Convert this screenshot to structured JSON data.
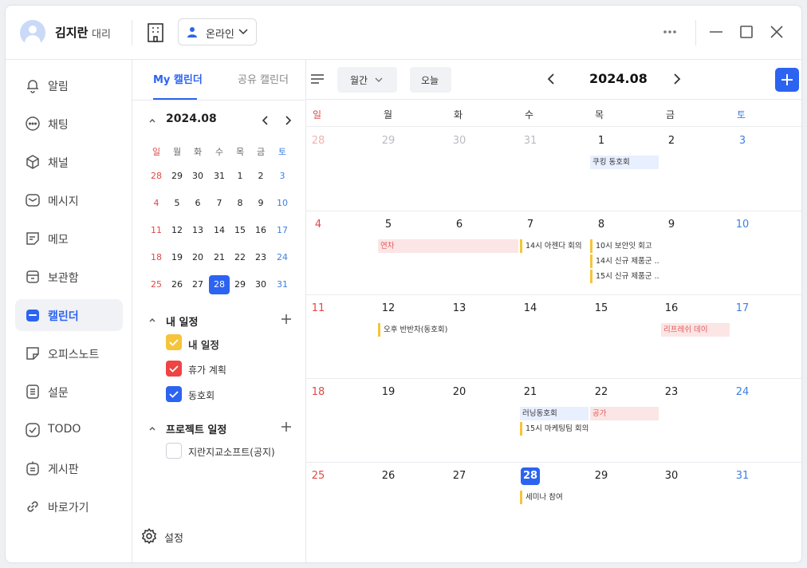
{
  "user": {
    "name": "김지란",
    "rank": "대리"
  },
  "status": {
    "label": "온라인"
  },
  "nav": [
    {
      "label": "알림",
      "icon": "bell-icon"
    },
    {
      "label": "채팅",
      "icon": "chat-icon"
    },
    {
      "label": "채널",
      "icon": "cube-icon"
    },
    {
      "label": "메시지",
      "icon": "envelope-icon"
    },
    {
      "label": "메모",
      "icon": "memo-icon"
    },
    {
      "label": "보관함",
      "icon": "archive-icon"
    },
    {
      "label": "캘린더",
      "icon": "calendar-icon"
    },
    {
      "label": "오피스노트",
      "icon": "note-icon"
    },
    {
      "label": "설문",
      "icon": "survey-icon"
    },
    {
      "label": "TODO",
      "icon": "check-circle-icon"
    },
    {
      "label": "게시판",
      "icon": "board-icon"
    },
    {
      "label": "바로가기",
      "icon": "link-icon"
    }
  ],
  "tabs": {
    "my": "My 캘린더",
    "shared": "공유 캘린더"
  },
  "mini_calendar": {
    "title": "2024.08",
    "weekdays": [
      "일",
      "월",
      "화",
      "수",
      "목",
      "금",
      "토"
    ],
    "weeks": [
      [
        "28",
        "29",
        "30",
        "31",
        "1",
        "2",
        "3"
      ],
      [
        "4",
        "5",
        "6",
        "7",
        "8",
        "9",
        "10"
      ],
      [
        "11",
        "12",
        "13",
        "14",
        "15",
        "16",
        "17"
      ],
      [
        "18",
        "19",
        "20",
        "21",
        "22",
        "23",
        "24"
      ],
      [
        "25",
        "26",
        "27",
        "28",
        "29",
        "30",
        "31"
      ]
    ]
  },
  "my_schedule": {
    "title": "내 일정",
    "items": [
      {
        "label": "내 일정",
        "color": "#f5c43a"
      },
      {
        "label": "휴가 계획",
        "color": "#ee4444"
      },
      {
        "label": "동호회",
        "color": "#2c63f1"
      }
    ]
  },
  "project_schedule": {
    "title": "프로젝트 일정",
    "items": [
      {
        "label": "지란지교소프트(공지)"
      }
    ]
  },
  "settings_label": "설정",
  "toolbar": {
    "view": "월간",
    "today": "오늘",
    "title": "2024.08"
  },
  "weekdays": [
    "일",
    "월",
    "화",
    "수",
    "목",
    "금",
    "토"
  ],
  "weeks": [
    [
      "28",
      "29",
      "30",
      "31",
      "1",
      "2",
      "3"
    ],
    [
      "4",
      "5",
      "6",
      "7",
      "8",
      "9",
      "10"
    ],
    [
      "11",
      "12",
      "13",
      "14",
      "15",
      "16",
      "17"
    ],
    [
      "18",
      "19",
      "20",
      "21",
      "22",
      "23",
      "24"
    ],
    [
      "25",
      "26",
      "27",
      "28",
      "29",
      "30",
      "31"
    ]
  ],
  "events": {
    "cooking": "쿠킹 동호회",
    "leave": "연차",
    "agenda": "14시 아젠다 회의",
    "security": "10시 보안잇 회고",
    "newprod1": "14시 신규 제품군 ...",
    "newprod2": "15시 신규 제품군 ...",
    "half": "오후 반반차(동호회)",
    "refresh": "리프레쉬 데이",
    "running": "러닝동호회",
    "marketing": "15시 마케팅팀 회의",
    "holiday": "공가",
    "seminar": "세미나 참여"
  }
}
